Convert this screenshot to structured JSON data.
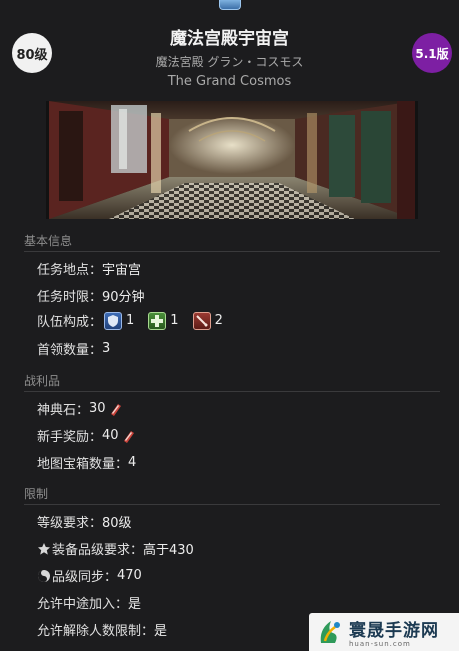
{
  "header": {
    "level_badge": "80级",
    "version_badge": "5.1版",
    "title_cn": "魔法宫殿宇宙宫",
    "title_jp": "魔法宮殿 グラン・コスモス",
    "title_en": "The Grand Cosmos",
    "duty_icon": "duty-icon"
  },
  "basic": {
    "heading": "基本信息",
    "location_label": "任务地点：",
    "location_value": "宇宙宫",
    "time_label": "任务时限：",
    "time_value": "90分钟",
    "party_label": "队伍构成：",
    "party": [
      {
        "role": "tank-icon",
        "count": "1"
      },
      {
        "role": "healer-icon",
        "count": "1"
      },
      {
        "role": "dps-icon",
        "count": "2"
      }
    ],
    "bosses_label": "首领数量：",
    "bosses_value": "3"
  },
  "loot": {
    "heading": "战利品",
    "tomestone_label": "神典石：",
    "tomestone_value": "30",
    "rookie_label": "新手奖励：",
    "rookie_value": "40",
    "chest_label": "地图宝箱数量：",
    "chest_value": "4"
  },
  "limits": {
    "heading": "限制",
    "level_label": "等级要求：",
    "level_value": "80级",
    "ilvl_label": "装备品级要求：",
    "ilvl_value": "高于430",
    "sync_label": "品级同步：",
    "sync_value": "470",
    "join_label": "允许中途加入：",
    "join_value": "是",
    "unrestricted_label": "允许解除人数限制：",
    "unrestricted_value": "是"
  },
  "watermark": {
    "name": "寰晟手游网",
    "url": "huan-sun.com"
  },
  "colors": {
    "background": "#1c1c1e",
    "version_badge": "#7d1fa3",
    "level_badge": "#f1f1f1"
  }
}
